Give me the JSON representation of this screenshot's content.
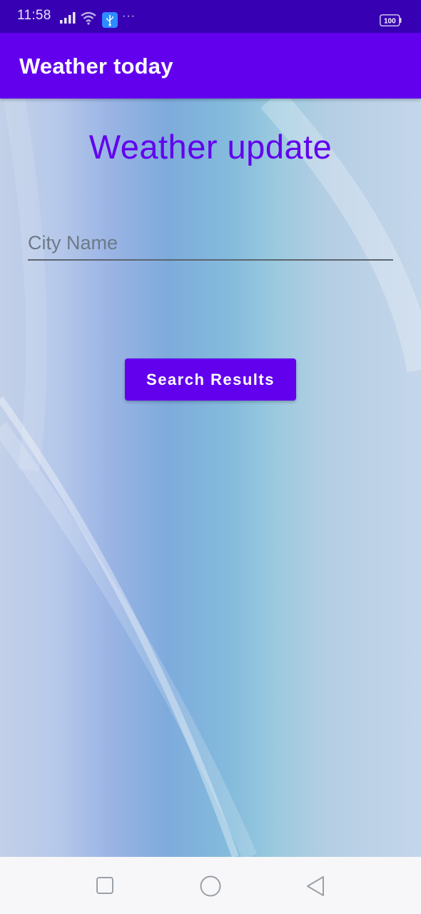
{
  "status_bar": {
    "time": "11:58",
    "battery": "100",
    "more_indicator": "···",
    "icons": [
      "signal-icon",
      "wifi-icon",
      "usb-icon",
      "battery-icon"
    ]
  },
  "app_bar": {
    "title": "Weather today"
  },
  "main": {
    "heading": "Weather update",
    "city_input": {
      "placeholder": "City Name",
      "value": ""
    },
    "search_button_label": "Search Results"
  },
  "nav_bar": {
    "icons": [
      "recents-square-icon",
      "home-circle-icon",
      "back-triangle-icon"
    ]
  },
  "colors": {
    "status_bar": "#3700b3",
    "primary": "#6200ee",
    "nav_bar": "#f7f7f9"
  }
}
